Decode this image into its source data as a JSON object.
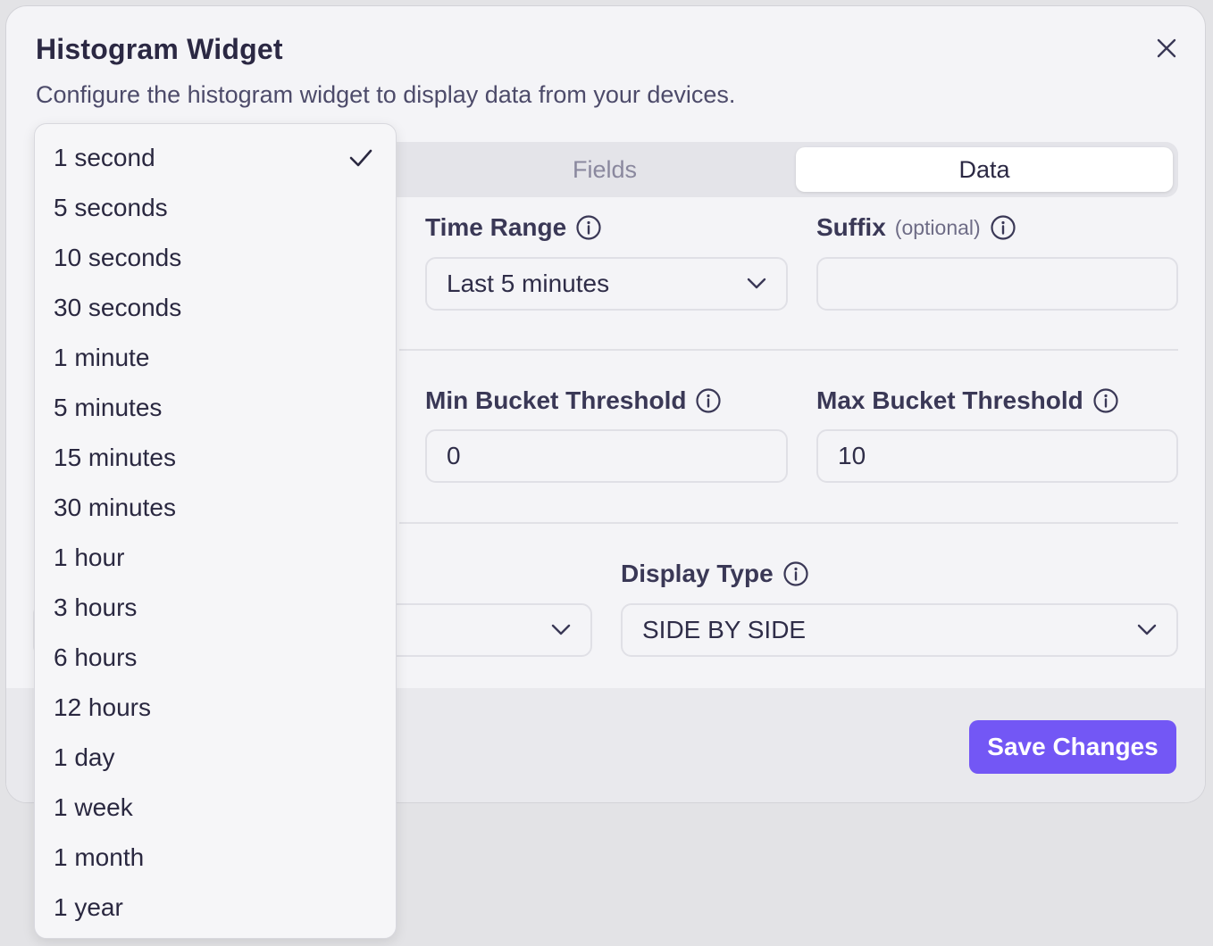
{
  "modal": {
    "title": "Histogram Widget",
    "subtitle": "Configure the histogram widget to display data from your devices."
  },
  "tabs": [
    {
      "label": "Fields",
      "active": false
    },
    {
      "label": "Data",
      "active": true
    }
  ],
  "time_range": {
    "label": "Time Range",
    "value": "Last 5 minutes"
  },
  "suffix": {
    "label": "Suffix",
    "optional_label": "(optional)",
    "value": ""
  },
  "min_bucket": {
    "label": "Min Bucket Threshold",
    "value": "0"
  },
  "max_bucket": {
    "label": "Max Bucket Threshold",
    "value": "10"
  },
  "display_type": {
    "label": "Display Type",
    "value": "SIDE BY SIDE"
  },
  "footer": {
    "save_label": "Save Changes"
  },
  "dropdown": {
    "selected": "1 second",
    "options": [
      "1 second",
      "5 seconds",
      "10 seconds",
      "30 seconds",
      "1 minute",
      "5 minutes",
      "15 minutes",
      "30 minutes",
      "1 hour",
      "3 hours",
      "6 hours",
      "12 hours",
      "1 day",
      "1 week",
      "1 month",
      "1 year"
    ]
  },
  "colors": {
    "accent": "#7357f5",
    "background": "#f4f4f7",
    "text": "#2b2843"
  },
  "icons": {
    "close": "close-icon",
    "info": "info-icon",
    "chevron": "chevron-down-icon",
    "check": "check-icon"
  }
}
